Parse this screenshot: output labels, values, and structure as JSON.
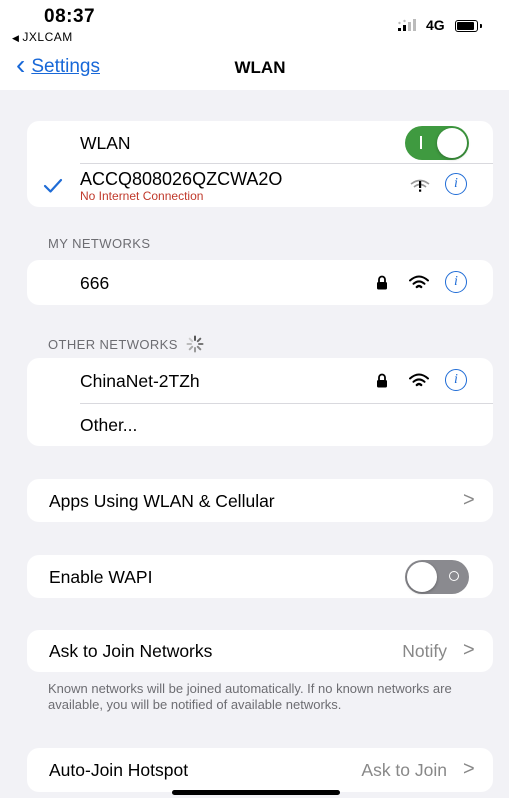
{
  "status_bar": {
    "time": "08:37",
    "back_app": "JXLCAM",
    "network": "4G"
  },
  "nav": {
    "back_label": "Settings",
    "title": "WLAN"
  },
  "wlan_group": {
    "wlan_label": "WLAN",
    "wlan_enabled": true,
    "connected_network": "ACCQ808026QZCWA2O",
    "connected_status": "No Internet Connection"
  },
  "my_networks": {
    "header": "MY NETWORKS",
    "items": [
      {
        "name": "666",
        "secured": true
      }
    ]
  },
  "other_networks": {
    "header": "OTHER NETWORKS",
    "items": [
      {
        "name": "ChinaNet-2TZh",
        "secured": true
      }
    ],
    "other_label": "Other..."
  },
  "apps_using": {
    "label": "Apps Using WLAN & Cellular"
  },
  "wapi": {
    "label": "Enable WAPI",
    "enabled": false
  },
  "ask_to_join": {
    "label": "Ask to Join Networks",
    "value": "Notify",
    "footer": "Known networks will be joined automatically. If no known networks are available, you will be notified of available networks."
  },
  "auto_join": {
    "label": "Auto-Join Hotspot",
    "value": "Ask to Join"
  },
  "colors": {
    "accent": "#1f6cd6",
    "toggle_on": "#3f9a40",
    "toggle_off": "#8a8a8f",
    "error_text": "#c0392b",
    "background": "#f2f2f6"
  }
}
